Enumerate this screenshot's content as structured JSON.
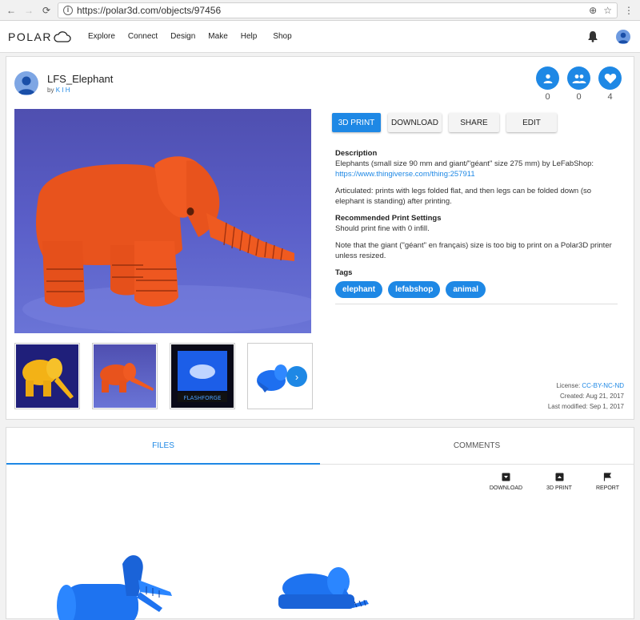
{
  "browser": {
    "url": "https://polar3d.com/objects/97456"
  },
  "navbar": {
    "logo": "POLAR",
    "menu": [
      "Explore",
      "Connect",
      "Design",
      "Make",
      "Help",
      "Shop"
    ]
  },
  "object": {
    "title": "LFS_Elephant",
    "by_label": "by",
    "author": "K I H",
    "stats": [
      {
        "icon": "person-icon",
        "count": "0"
      },
      {
        "icon": "group-icon",
        "count": "0"
      },
      {
        "icon": "heart-icon",
        "count": "4"
      }
    ]
  },
  "actions": {
    "print": "3D PRINT",
    "download": "DOWNLOAD",
    "share": "SHARE",
    "edit": "EDIT"
  },
  "description": {
    "heading": "Description",
    "line1": "Elephants (small size 90 mm and giant/\"géant\" size 275 mm) by LeFabShop:",
    "link": "https://www.thingiverse.com/thing:257911",
    "articulated": "Articulated: prints with legs folded flat, and then legs can be folded down (so elephant is standing) after printing.",
    "settings_heading": "Recommended Print Settings",
    "settings_text": "Should print fine with 0 infill.",
    "note": "Note that the giant (\"géant\" en français) size is too big to print on a Polar3D printer unless resized.",
    "tags_heading": "Tags",
    "tags": [
      "elephant",
      "lefabshop",
      "animal"
    ]
  },
  "meta": {
    "license_label": "License:",
    "license_value": "CC-BY-NC-ND",
    "created": "Created: Aug 21, 2017",
    "modified": "Last modified: Sep 1, 2017"
  },
  "tabs": {
    "files": "FILES",
    "comments": "COMMENTS"
  },
  "file_actions": {
    "download": "DOWNLOAD",
    "print": "3D PRINT",
    "report": "REPORT"
  },
  "colors": {
    "accent": "#1e88e5",
    "elephant": "#f0561e"
  }
}
